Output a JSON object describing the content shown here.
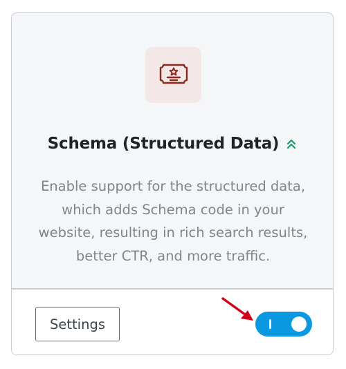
{
  "module": {
    "title": "Schema (Structured Data)",
    "badge_icon": "double-chevron-up-icon",
    "icon": "certificate-icon",
    "description": "Enable support for the structured data, which adds Schema code in your website, resulting in rich search results, better CTR, and more traffic.",
    "settings_label": "Settings",
    "enabled": true
  },
  "colors": {
    "accent_toggle": "#0a98e0",
    "icon_tile_bg": "#f4e7e7",
    "icon_color": "#8a2a1d",
    "badge_color": "#1c9a6b",
    "annotation_arrow": "#d0021b"
  },
  "annotation": {
    "icon": "red-arrow-icon"
  }
}
